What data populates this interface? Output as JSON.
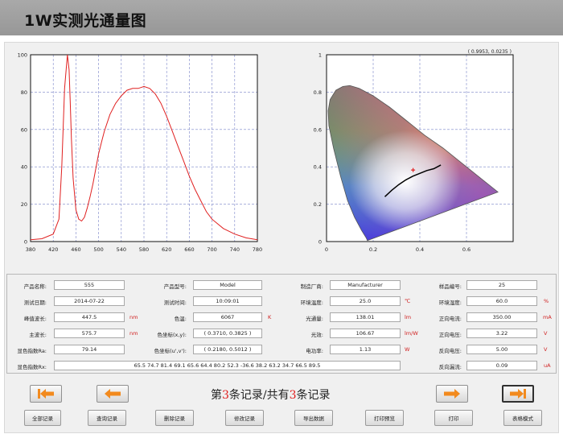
{
  "window": {
    "title": "1W实测光通量图"
  },
  "chart_data": [
    {
      "type": "line",
      "x_ticks": [
        "380",
        "420",
        "460",
        "500",
        "540",
        "580",
        "620",
        "660",
        "700",
        "740",
        "780"
      ],
      "y_ticks": [
        "100",
        "80",
        "60",
        "40",
        "20",
        "0"
      ],
      "xlim": [
        380,
        780
      ],
      "ylim": [
        0,
        100
      ],
      "grid": true,
      "series": [
        {
          "color": "#e02020",
          "x": [
            380,
            400,
            420,
            430,
            435,
            440,
            445,
            448,
            450,
            452,
            455,
            460,
            465,
            470,
            475,
            480,
            485,
            490,
            495,
            500,
            505,
            510,
            520,
            530,
            540,
            550,
            560,
            570,
            580,
            590,
            600,
            610,
            620,
            630,
            640,
            650,
            660,
            670,
            680,
            690,
            700,
            720,
            740,
            760,
            780
          ],
          "y": [
            1,
            1.5,
            4,
            12,
            40,
            82,
            100,
            92,
            75,
            55,
            34,
            17,
            12,
            11,
            13,
            18,
            24,
            31,
            39,
            47,
            53,
            59,
            68,
            74,
            78,
            81,
            82,
            82,
            83,
            82,
            79,
            74,
            67,
            59,
            51,
            43,
            35,
            28,
            22,
            16,
            12,
            7,
            4,
            2,
            1
          ]
        }
      ]
    },
    {
      "type": "scatter",
      "coordinate_readout": "( 0.9953, 0.0235 )",
      "x_ticks": [
        "0",
        "0.2",
        "0.4",
        "0.6"
      ],
      "y_ticks": [
        "1",
        "0.8",
        "0.6",
        "0.4",
        "0.2",
        "0"
      ],
      "xlim": [
        0,
        0.8
      ],
      "ylim": [
        0,
        1
      ],
      "grid": true,
      "locus": {
        "color": "#000000",
        "x": [
          0.25,
          0.28,
          0.31,
          0.34,
          0.37,
          0.4,
          0.43,
          0.46,
          0.49
        ],
        "y": [
          0.24,
          0.275,
          0.305,
          0.33,
          0.35,
          0.365,
          0.38,
          0.39,
          0.41
        ]
      },
      "points": [
        {
          "x": 0.371,
          "y": 0.383,
          "color": "#e02020",
          "marker": "+"
        }
      ]
    }
  ],
  "params": {
    "product_name": {
      "label": "产品名称:",
      "value": "555"
    },
    "product_model": {
      "label": "产品型号:",
      "value": "Model"
    },
    "manufacturer": {
      "label": "制造厂商:",
      "value": "Manufacturer"
    },
    "sample_no": {
      "label": "样品编号:",
      "value": "25"
    },
    "test_date": {
      "label": "测试日期:",
      "value": "2014-07-22"
    },
    "test_time": {
      "label": "测试时间:",
      "value": "10:09:01"
    },
    "ambient_temp": {
      "label": "环境温度:",
      "value": "25.0",
      "unit": "℃"
    },
    "ambient_humidity": {
      "label": "环境湿度:",
      "value": "60.0",
      "unit": "%"
    },
    "peak_wavelength": {
      "label": "峰值波长:",
      "value": "447.5",
      "unit": "nm"
    },
    "color_temp": {
      "label": "色温:",
      "value": "6067",
      "unit": "K"
    },
    "luminous_flux": {
      "label": "光通量:",
      "value": "138.01",
      "unit": "lm"
    },
    "forward_current": {
      "label": "正向电流:",
      "value": "350.00",
      "unit": "mA"
    },
    "dominant_wavelength": {
      "label": "主波长:",
      "value": "575.7",
      "unit": "nm"
    },
    "chromaticity_xy": {
      "label": "色坐标(x,y):",
      "value": "( 0.3710, 0.3825 )"
    },
    "luminous_efficacy": {
      "label": "光效:",
      "value": "106.67",
      "unit": "lm/W"
    },
    "forward_voltage": {
      "label": "正向电压:",
      "value": "3.22",
      "unit": "V"
    },
    "cri": {
      "label": "显色指数Ra:",
      "value": "79.14"
    },
    "chromaticity_uv": {
      "label": "色坐标(u',v'):",
      "value": "( 0.2180, 0.5012 )"
    },
    "power": {
      "label": "电功率:",
      "value": "1.13",
      "unit": "W"
    },
    "reverse_voltage": {
      "label": "反向电压:",
      "value": "5.00",
      "unit": "V"
    },
    "cri_values": {
      "label": "显色指数Rx:",
      "value": "65.5 74.7 81.4 69.1 65.6 64.4 80.2 52.3 -36.6 38.2 63.2 34.7 66.5 89.5"
    },
    "reverse_current": {
      "label": "反向漏流:",
      "value": "0.09",
      "unit": "uA"
    }
  },
  "records": {
    "prefix": "第",
    "current": "3",
    "mid": "条记录/共有",
    "total": "3",
    "suffix": "条记录"
  },
  "nav_icons": [
    "first-record-icon",
    "previous-record-icon",
    "next-record-icon",
    "last-record-icon"
  ],
  "nav_color": "#f28a1e",
  "actions": [
    "全部记录",
    "查询记录",
    "删除记录",
    "修改记录",
    "导出数据",
    "打印预览",
    "打印",
    "表格模式"
  ]
}
